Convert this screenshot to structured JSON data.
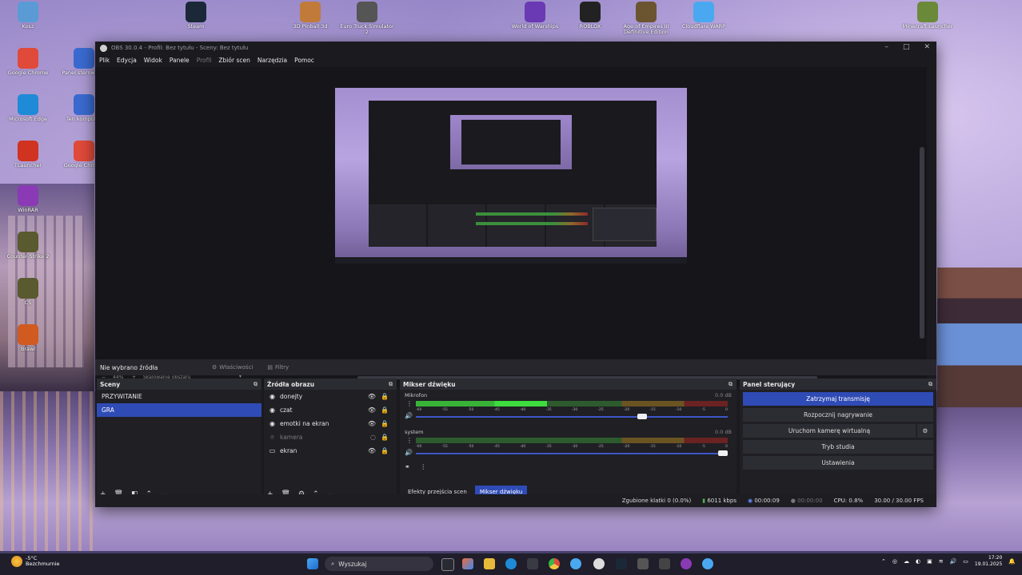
{
  "desktop": {
    "icons": [
      {
        "label": "Kosz",
        "icon": "recycle-bin-icon",
        "color": "#5b9bd5"
      },
      {
        "label": "Steam",
        "icon": "steam-icon",
        "color": "#1b2838"
      },
      {
        "label": "3D Pinball 3d",
        "icon": "game-icon",
        "color": "#c07a3a"
      },
      {
        "label": "Euro Truck Simulator 2",
        "icon": "truck-icon",
        "color": "#555"
      },
      {
        "label": "World of Warships",
        "icon": "game-icon",
        "color": "#6a3ab5"
      },
      {
        "label": "ROBLOX",
        "icon": "game-icon",
        "color": "#222"
      },
      {
        "label": "Age of Empires III Definitive Edition",
        "icon": "game-icon",
        "color": "#6b5530"
      },
      {
        "label": "Cloudflare WARP",
        "icon": "app-icon",
        "color": "#4aa8f0"
      },
      {
        "label": "Minecraft Launcher",
        "icon": "game-icon",
        "color": "#6a8a3a"
      },
      {
        "label": "Google Chrome",
        "icon": "chrome-icon",
        "color": "#e04a3a"
      },
      {
        "label": "Panel sterowania",
        "icon": "control-panel-icon",
        "color": "#3a6ad0"
      },
      {
        "label": "Microsoft Edge",
        "icon": "edge-icon",
        "color": "#1f8ad6"
      },
      {
        "label": "Ten komputer",
        "icon": "computer-icon",
        "color": "#3a6ad0"
      },
      {
        "label": "TLauncher",
        "icon": "app-icon",
        "color": "#d0331f"
      },
      {
        "label": "Google Chrome",
        "icon": "chrome-icon",
        "color": "#e04a3a"
      },
      {
        "label": "WinRAR",
        "icon": "winrar-icon",
        "color": "#8a3ab5"
      },
      {
        "label": "Counter-Strike 2",
        "icon": "game-icon",
        "color": "#5a5a30"
      },
      {
        "label": "CS",
        "icon": "game-icon",
        "color": "#5a5a30"
      },
      {
        "label": "Brawl",
        "icon": "game-icon",
        "color": "#d05a1f"
      }
    ]
  },
  "obs": {
    "title": "OBS 30.0.4 - Profil: Bez tytułu - Sceny: Bez tytułu",
    "menu": [
      "Plik",
      "Edycja",
      "Widok",
      "Panele",
      "Profil",
      "Zbiór scen",
      "Narzędzia",
      "Pomoc"
    ],
    "zoom_label": "44%",
    "zoom_mode": "Skalowanie obszaru",
    "no_source": "Nie wybrano źródła",
    "properties_btn": "Właściwości",
    "filters_btn": "Filtry",
    "scenes": {
      "title": "Sceny",
      "items": [
        "PRZYWITANIE",
        "GRA"
      ],
      "selected": 1
    },
    "sources": {
      "title": "Źródła obrazu",
      "items": [
        {
          "label": "donejty",
          "icon": "browser-icon",
          "visible": true
        },
        {
          "label": "czat",
          "icon": "browser-icon",
          "visible": true
        },
        {
          "label": "emotki na ekran",
          "icon": "browser-icon",
          "visible": true
        },
        {
          "label": "kamera",
          "icon": "camera-icon",
          "visible": false
        },
        {
          "label": "ekran",
          "icon": "monitor-icon",
          "visible": true
        }
      ]
    },
    "mixer": {
      "title": "Mikser dźwięku",
      "tracks": [
        {
          "name": "Mikrofon",
          "db": "0.0 dB",
          "level": 0.42,
          "volume": 0.74
        },
        {
          "name": "system",
          "db": "0.0 dB",
          "level": 0.0,
          "volume": 1.0
        }
      ],
      "ticks": [
        "-60",
        "-55",
        "-50",
        "-45",
        "-40",
        "-35",
        "-30",
        "-25",
        "-20",
        "-15",
        "-10",
        "-5",
        "0"
      ],
      "tabs": [
        "Efekty przejścia scen",
        "Mikser dźwięku"
      ],
      "active_tab": 1
    },
    "controls": {
      "title": "Panel sterujący",
      "buttons": [
        "Zatrzymaj transmisję",
        "Rozpocznij nagrywanie",
        "Uruchom kamerę wirtualną",
        "Tryb studia",
        "Ustawienia"
      ]
    },
    "status": {
      "dropped": "Zgubione klatki 0 (0.0%)",
      "bitrate": "6011 kbps",
      "stream_time": "00:00:09",
      "rec_time": "00:00:00",
      "cpu": "CPU: 0.8%",
      "fps": "30.00 / 30.00 FPS",
      "accent": "#2f4bb5"
    }
  },
  "taskbar": {
    "weather_temp": "-5°C",
    "weather_text": "Bezchmurnie",
    "search_placeholder": "Wyszukaj",
    "time": "17:20",
    "date": "19.01.2025"
  }
}
